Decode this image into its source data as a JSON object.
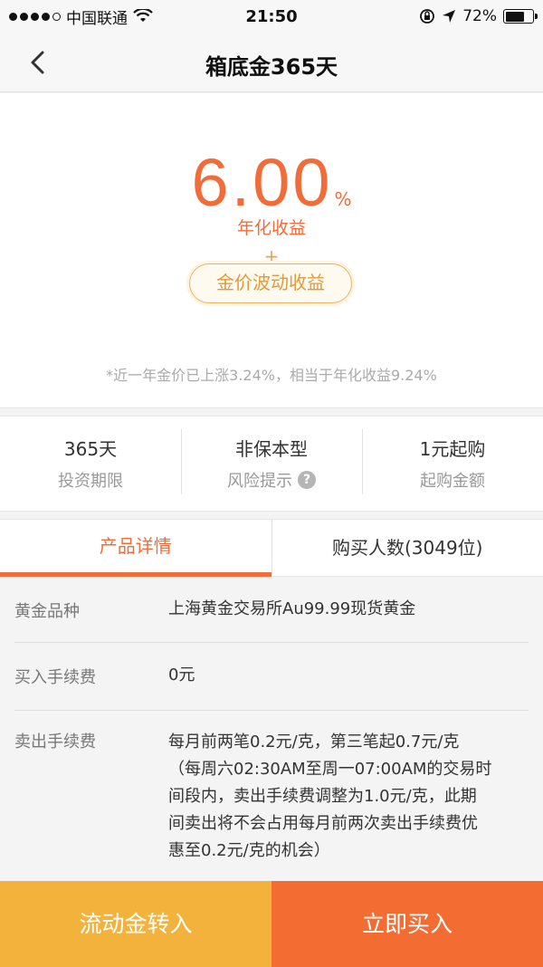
{
  "status_bar": {
    "carrier": "中国联通",
    "time": "21:50",
    "battery_percent": "72%",
    "battery_level": 0.72,
    "signal_bars": 4,
    "icons": [
      "wifi-icon",
      "rotation-lock-icon",
      "location-arrow-icon",
      "battery-icon"
    ]
  },
  "nav": {
    "title": "箱底金365天",
    "back_icon": "chevron-left-icon"
  },
  "hero": {
    "rate_value": "6.00",
    "rate_unit": "%",
    "rate_label": "年化收益",
    "plus": "+",
    "gold_pill_label": "金价波动收益",
    "note": "*近一年金价已上涨3.24%，相当于年化收益9.24%"
  },
  "info": [
    {
      "value": "365天",
      "label": "投资期限"
    },
    {
      "value": "非保本型",
      "label": "风险提示",
      "help_icon": "?"
    },
    {
      "value": "1元起购",
      "label": "起购金额"
    }
  ],
  "tabs": [
    {
      "label": "产品详情",
      "active": true
    },
    {
      "label": "购买人数(3049位)",
      "active": false
    }
  ],
  "details": [
    {
      "key": "黄金品种",
      "value": "上海黄金交易所Au99.99现货黄金"
    },
    {
      "key": "买入手续费",
      "value": "0元"
    },
    {
      "key": "卖出手续费",
      "value_lines": [
        "每月前两笔0.2元/克，第三笔起0.7元/克",
        "（每周六02:30AM至周一07:00AM的交易时",
        "间段内，卖出手续费调整为1.0元/克，此期",
        "间卖出将不会占用每月前两次卖出手续费优",
        "惠至0.2元/克的机会）"
      ]
    }
  ],
  "buttons": {
    "transfer": "流动金转入",
    "buy": "立即买入"
  },
  "colors": {
    "accent_orange": "#f06d3a",
    "gold": "#e09a3a",
    "transfer_button": "#f2b23c",
    "buy_button": "#f36d33"
  }
}
